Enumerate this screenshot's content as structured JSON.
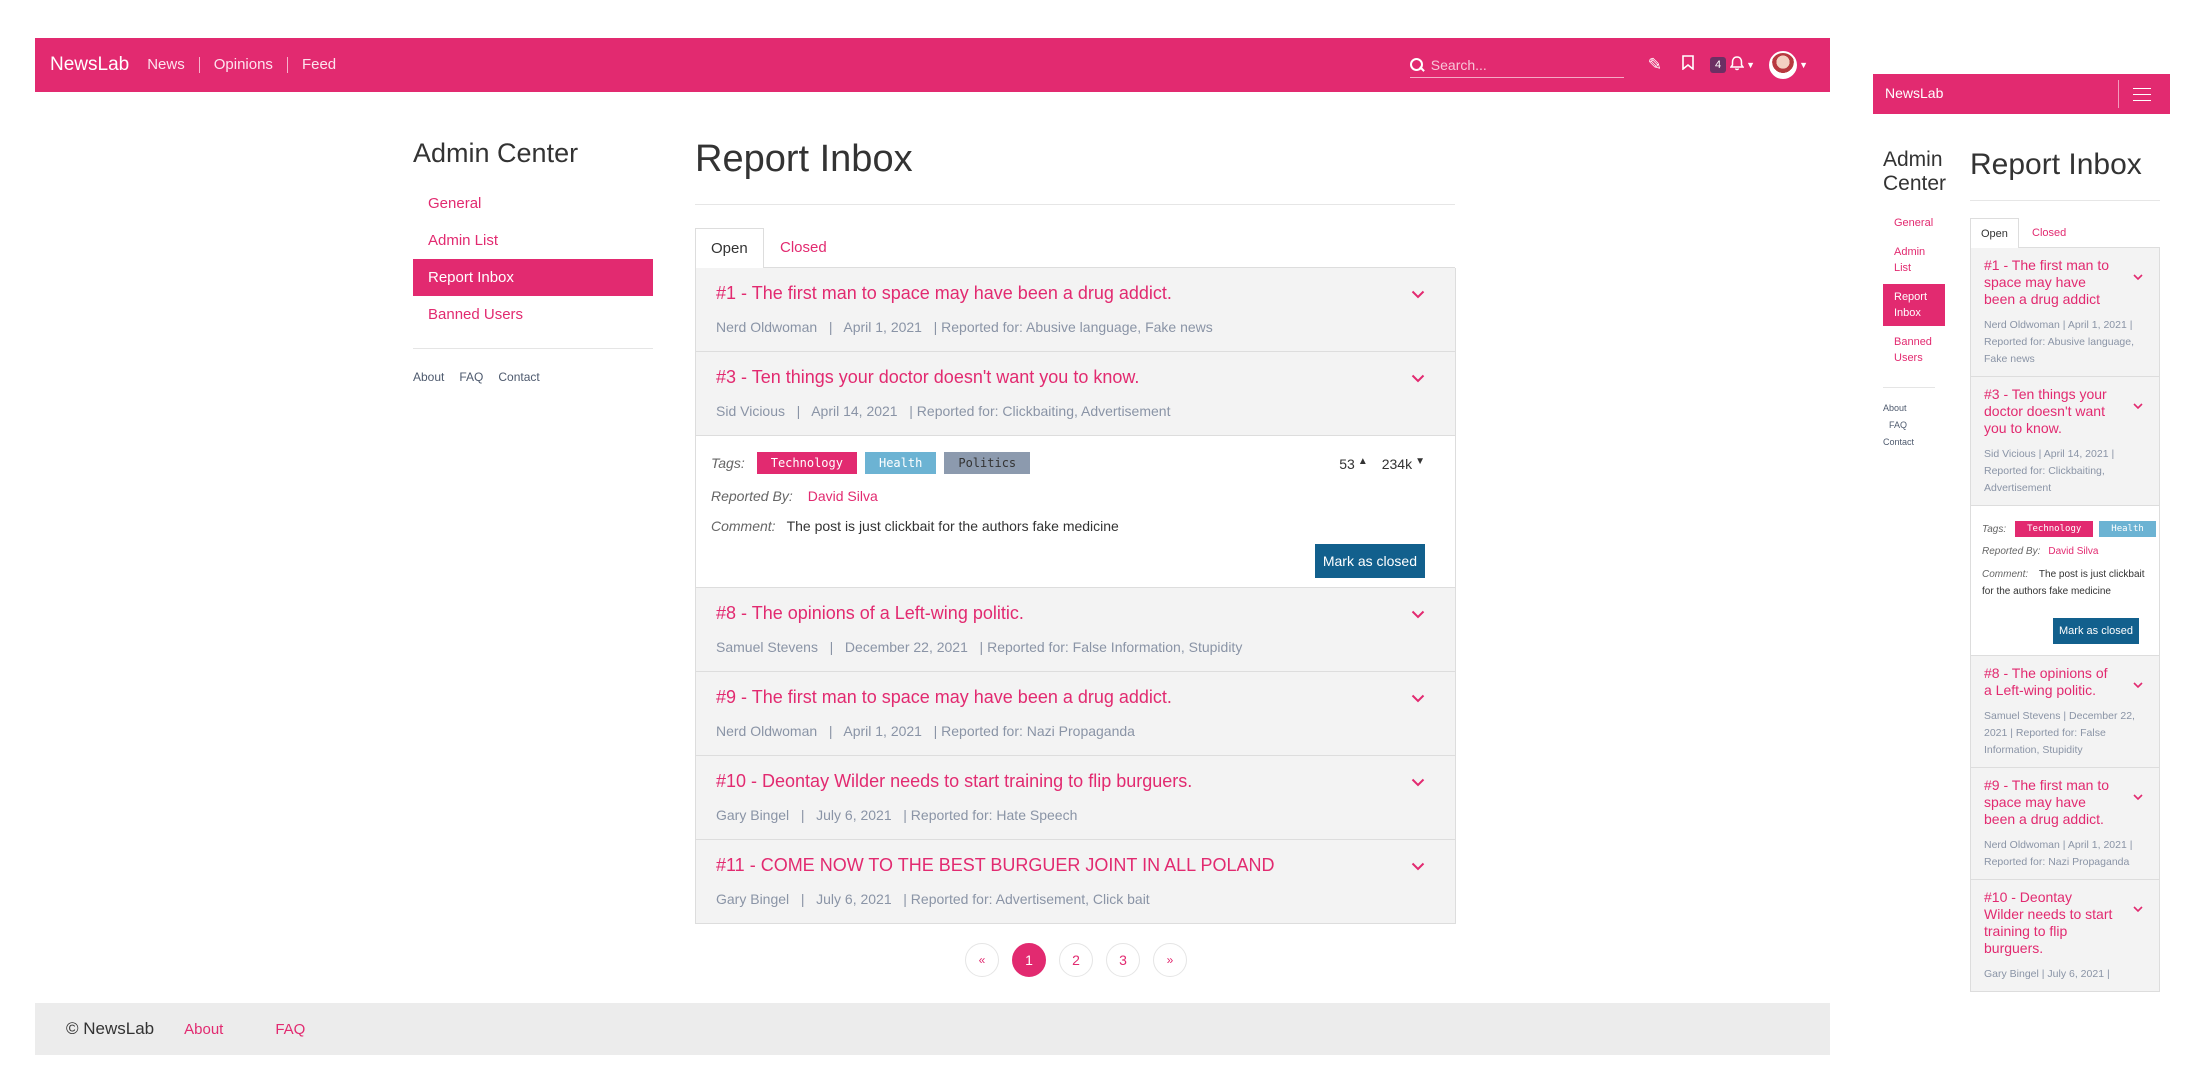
{
  "desktop": {
    "brand": "NewsLab",
    "nav_links": [
      "News",
      "Opinions",
      "Feed"
    ],
    "search_placeholder": "Search...",
    "notification_count": "4",
    "sidebar": {
      "title": "Admin Center",
      "items": [
        "General",
        "Admin List",
        "Report Inbox",
        "Banned Users"
      ],
      "active": "Report Inbox",
      "footer_links": [
        "About",
        "FAQ",
        "Contact"
      ]
    },
    "main": {
      "title": "Report Inbox",
      "tabs": [
        "Open",
        "Closed"
      ],
      "active_tab": "Open"
    },
    "reports": [
      {
        "title": "#1 - The first man to space may have been a drug addict.",
        "meta": "Nerd Oldwoman   |   April 1, 2021   | Reported for: Abusive language, Fake news"
      },
      {
        "title": "#3 - Ten things your doctor doesn't want you to know.",
        "meta": "Sid Vicious   |   April 14, 2021   | Reported for: Clickbaiting, Advertisement"
      },
      {
        "title": "#8 - The opinions of a Left-wing politic.",
        "meta": "Samuel Stevens   |   December 22, 2021   | Reported for: False Information, Stupidity"
      },
      {
        "title": "#9 - The first man to space may have been a drug addict.",
        "meta": "Nerd Oldwoman   |   April 1, 2021   | Reported for: Nazi Propaganda"
      },
      {
        "title": "#10 - Deontay Wilder needs to start training to flip burguers.",
        "meta": "Gary Bingel   |   July 6, 2021   | Reported for: Hate Speech"
      },
      {
        "title": "#11 - COME NOW TO THE BEST BURGUER JOINT IN ALL POLAND",
        "meta": "Gary Bingel   |   July 6, 2021   | Reported for: Advertisement, Click bait"
      }
    ],
    "expanded": {
      "tags_label": "Tags:",
      "tags": [
        "Technology",
        "Health",
        "Politics"
      ],
      "upvotes": "53",
      "downvotes": "234k",
      "reported_by_label": "Reported By:",
      "reported_by": "David Silva",
      "comment_label": "Comment:",
      "comment": "The post is just clickbait for the authors fake medicine",
      "button": "Mark as closed"
    },
    "pagination": {
      "prev": "«",
      "pages": [
        "1",
        "2",
        "3"
      ],
      "next": "»",
      "current": "1"
    },
    "footer": {
      "copyright": "© NewsLab",
      "links": [
        "About",
        "FAQ"
      ]
    }
  },
  "mobile": {
    "brand": "NewsLab",
    "sidebar": {
      "title": "Admin Center",
      "items": [
        "General",
        "Admin List",
        "Report Inbox",
        "Banned Users"
      ],
      "footer_links": [
        "About",
        "FAQ",
        "Contact"
      ]
    },
    "main": {
      "title": "Report Inbox",
      "tabs": [
        "Open",
        "Closed"
      ]
    },
    "reports": [
      {
        "title": "#1 - The first man to space may have been a drug addict",
        "meta": "Nerd Oldwoman  |  April 1, 2021  | Reported for: Abusive language, Fake news"
      },
      {
        "title": "#3 - Ten things your doctor doesn't want you to know.",
        "meta": "Sid Vicious  |  April 14, 2021  | Reported for: Clickbaiting, Advertisement"
      },
      {
        "title": "#8 - The opinions of a Left-wing politic.",
        "meta": "Samuel Stevens  |  December 22, 2021  | Reported for: False Information, Stupidity"
      },
      {
        "title": "#9 - The first man to space may have been a drug addict.",
        "meta": "Nerd Oldwoman  |  April 1, 2021  | Reported for: Nazi Propaganda"
      },
      {
        "title": "#10 - Deontay Wilder needs to start training to flip burguers.",
        "meta": "Gary Bingel  |  July 6, 2021  |"
      }
    ],
    "expanded": {
      "tags_label": "Tags:",
      "tags": [
        "Technology",
        "Health"
      ],
      "reported_by_label": "Reported By:",
      "reported_by": "David Silva",
      "comment_label": "Comment:",
      "comment": "The post is just clickbait for the authors fake medicine",
      "button": "Mark as closed"
    }
  },
  "colors": {
    "brand": "#e22a70",
    "button": "#12608d",
    "muted": "#8a94a6"
  },
  "icons": [
    "search-icon",
    "edit-icon",
    "bookmark-icon",
    "bell-icon",
    "chevron-down-icon",
    "chevron-up-icon",
    "hamburger-icon"
  ]
}
